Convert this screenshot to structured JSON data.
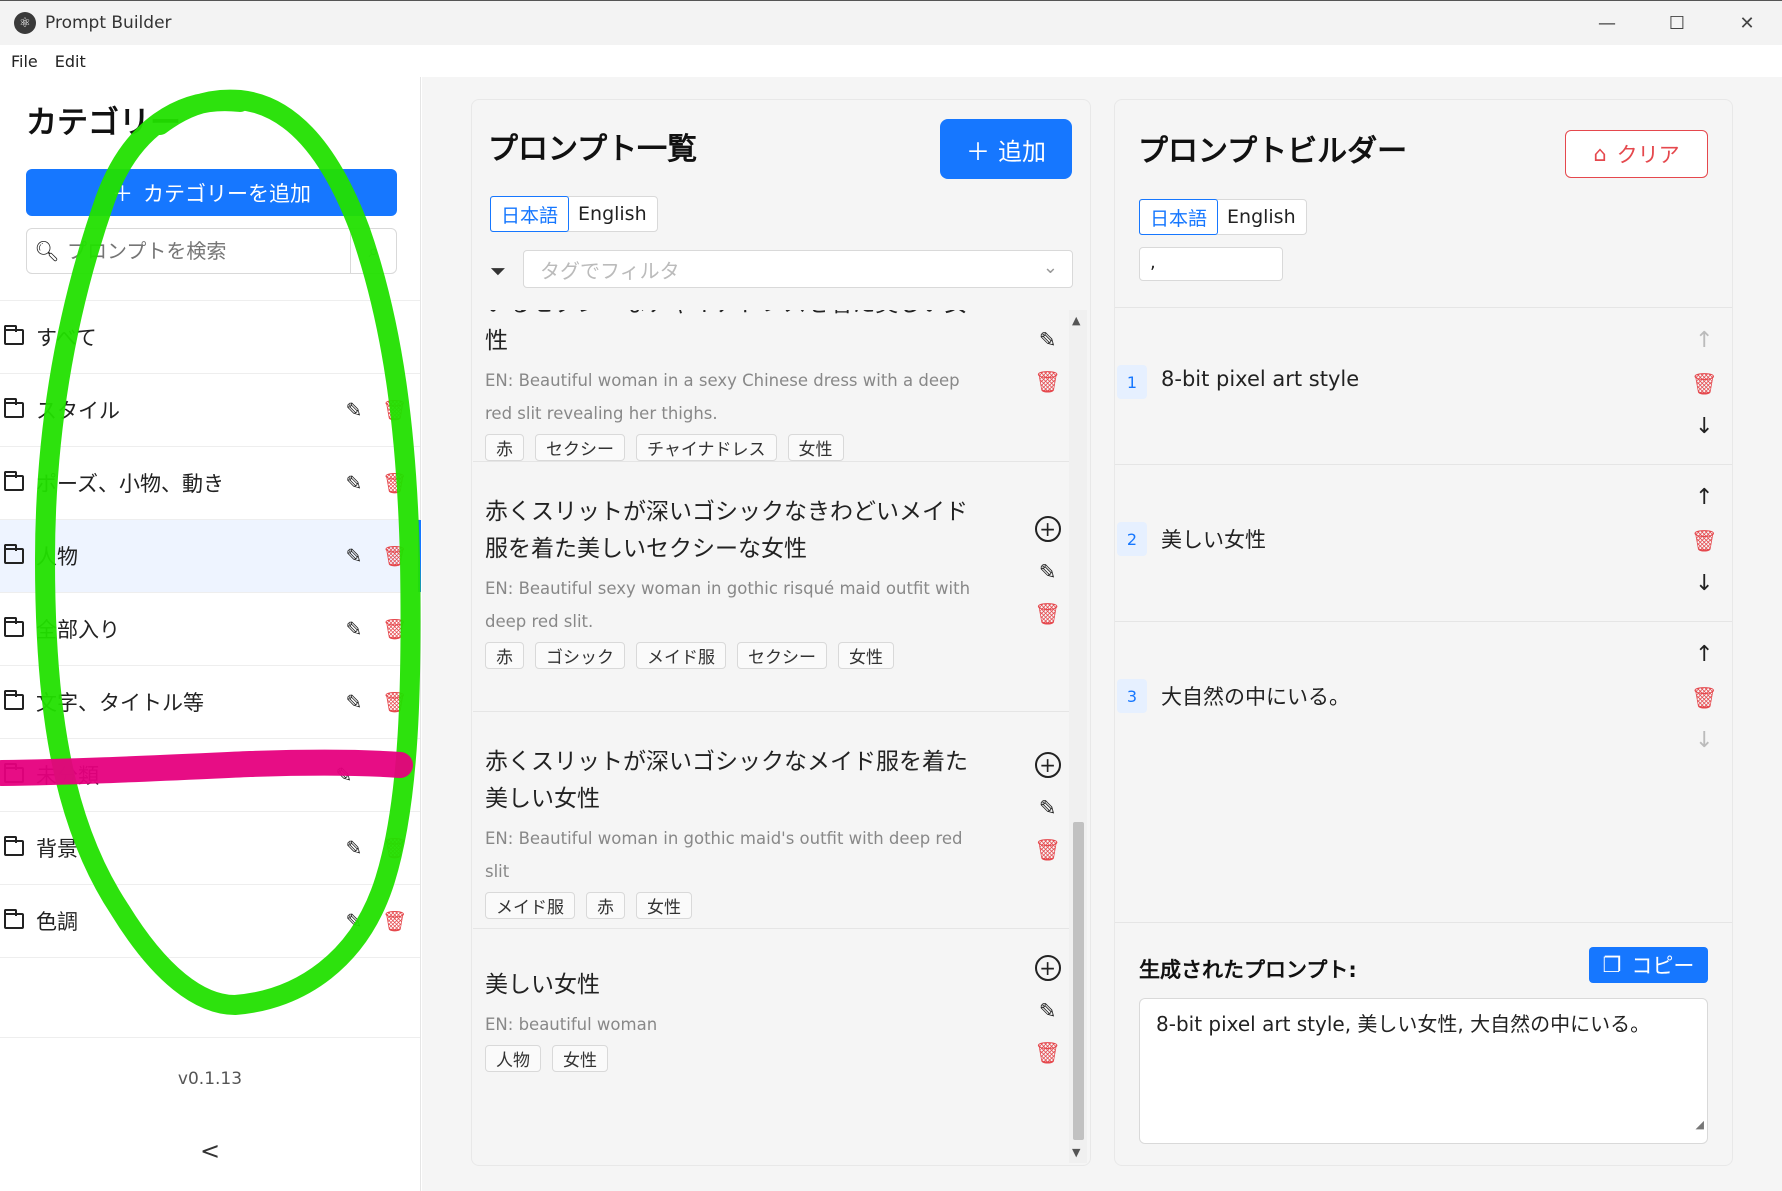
{
  "window": {
    "title": "Prompt Builder",
    "app_icon": "atom-icon"
  },
  "menu": {
    "items": [
      "File",
      "Edit"
    ]
  },
  "sidebar": {
    "title": "カテゴリー",
    "add_button": "カテゴリーを追加",
    "search_placeholder": "プロンプトを検索",
    "categories": [
      {
        "label": "すべて",
        "editable": false
      },
      {
        "label": "スタイル",
        "editable": true
      },
      {
        "label": "ポーズ、小物、動き",
        "editable": true
      },
      {
        "label": "人物",
        "editable": true,
        "active": true
      },
      {
        "label": "全部入り",
        "editable": true
      },
      {
        "label": "文字、タイトル等",
        "editable": true
      },
      {
        "label": "未分類",
        "editable": true
      },
      {
        "label": "背景",
        "editable": true
      },
      {
        "label": "色調",
        "editable": true
      }
    ],
    "version": "v0.1.13",
    "collapse_label": "<"
  },
  "prompt_list": {
    "title": "プロンプト一覧",
    "add_button": "追加",
    "lang_options": [
      "日本語",
      "English"
    ],
    "lang_selected": "日本語",
    "tag_filter_placeholder": "タグでフィルタ",
    "items": [
      {
        "title": "いるセクシーなチャイナドレスを着た美しい女性",
        "en": "EN: Beautiful woman in a sexy Chinese dress with a deep red slit revealing her thighs.",
        "tags": [
          "赤",
          "セクシー",
          "チャイナドレス",
          "女性"
        ]
      },
      {
        "title": "赤くスリットが深いゴシックなきわどいメイド服を着た美しいセクシーな女性",
        "en": "EN: Beautiful sexy woman in gothic risqué maid outfit with deep red slit.",
        "tags": [
          "赤",
          "ゴシック",
          "メイド服",
          "セクシー",
          "女性"
        ]
      },
      {
        "title": "赤くスリットが深いゴシックなメイド服を着た美しい女性",
        "en": "EN: Beautiful woman in gothic maid's outfit with deep red slit",
        "tags": [
          "メイド服",
          "赤",
          "女性"
        ]
      },
      {
        "title": "美しい女性",
        "en": "EN: beautiful woman",
        "tags": [
          "人物",
          "女性"
        ]
      }
    ]
  },
  "builder": {
    "title": "プロンプトビルダー",
    "clear_button": "クリア",
    "lang_options": [
      "日本語",
      "English"
    ],
    "lang_selected": "日本語",
    "separator_value": ",",
    "items": [
      {
        "num": "1",
        "text": "8-bit pixel art style"
      },
      {
        "num": "2",
        "text": "美しい女性"
      },
      {
        "num": "3",
        "text": "大自然の中にいる。"
      }
    ],
    "generated_label": "生成されたプロンプト:",
    "copy_button": "コピー",
    "generated_text": "8-bit pixel art style, 美しい女性, 大自然の中にいる。"
  },
  "annotations": {
    "circle_color": "#22e000",
    "strike_color": "#e6007e"
  },
  "colors": {
    "primary": "#1677ff",
    "danger": "#e5484d"
  }
}
